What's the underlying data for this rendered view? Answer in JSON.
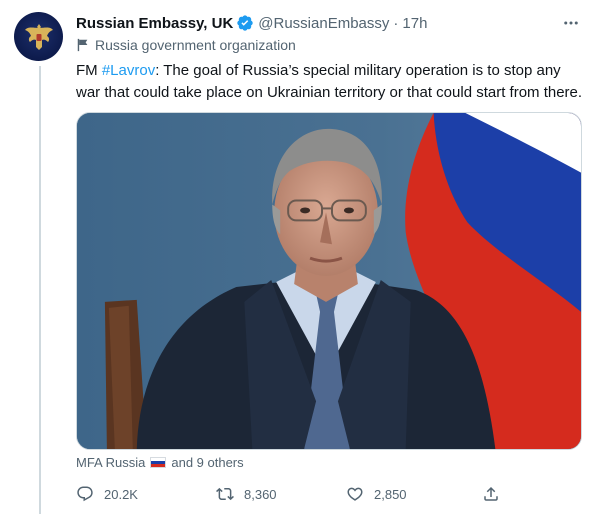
{
  "author": {
    "name": "Russian Embassy, UK",
    "handle": "@RussianEmbassy",
    "time": "17h",
    "label": "Russia government organization",
    "verified": true
  },
  "tweet": {
    "prefix": "FM ",
    "hashtag": "#Lavrov",
    "text": ": The goal of Russia’s special military operation is to stop any war that could take place on Ukrainian territory or that could start from there."
  },
  "tagged": {
    "first": "MFA Russia",
    "rest": "and 9 others"
  },
  "actions": {
    "replies": "20.2K",
    "retweets": "8,360",
    "likes": "2,850"
  },
  "colors": {
    "accent": "#1d9bf0",
    "muted": "#536471",
    "flag_white": "#ffffff",
    "flag_blue": "#1c3fa8",
    "flag_red": "#d52b1e"
  },
  "icons": {
    "more": "more-icon",
    "label": "flag-label-icon",
    "verified": "verified-badge-icon",
    "reply": "reply-icon",
    "retweet": "retweet-icon",
    "like": "heart-icon",
    "share": "share-icon"
  }
}
